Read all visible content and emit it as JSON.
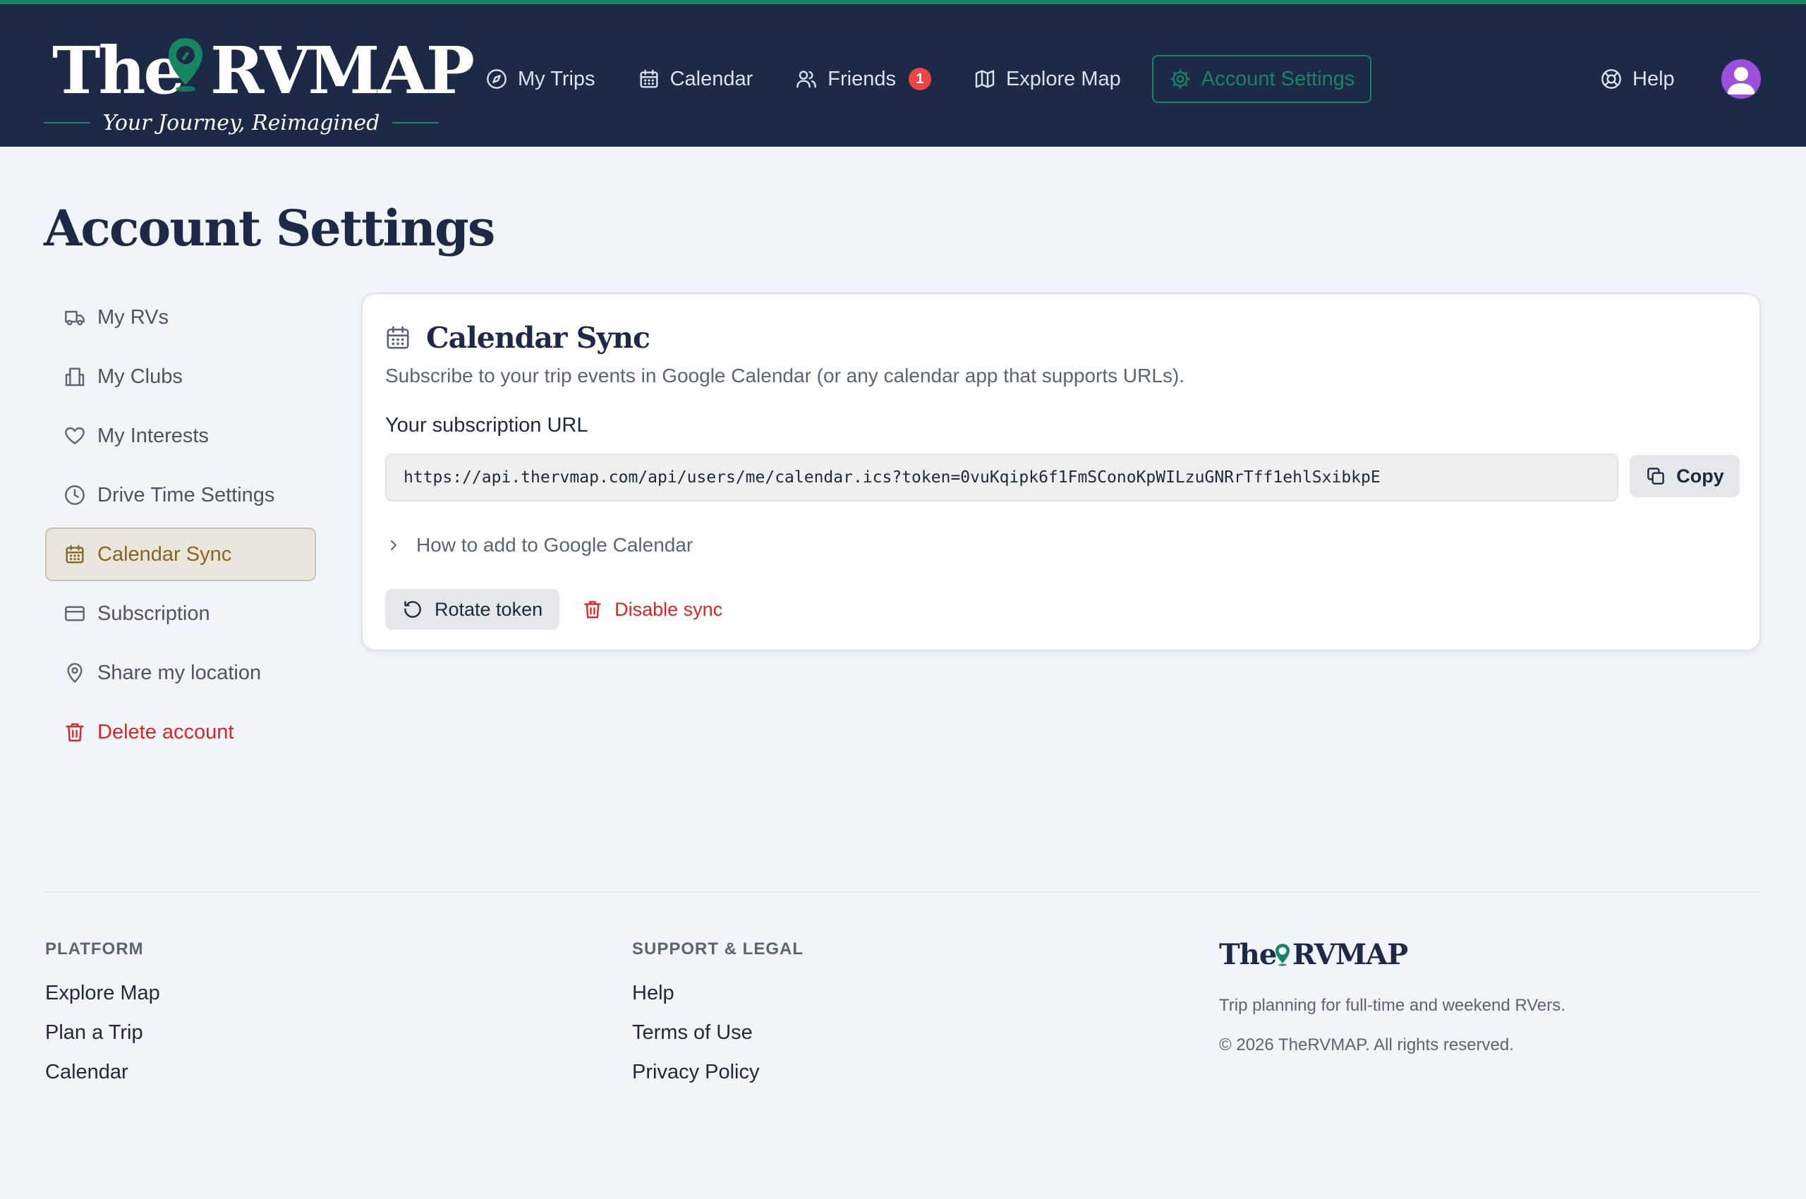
{
  "brand": {
    "word_left": "The",
    "word_right": "RVMAP",
    "tagline": "Your Journey, Reimagined",
    "accent_color": "#17855f",
    "header_bg": "#1c2a48"
  },
  "nav": {
    "items": [
      {
        "label": "My Trips",
        "icon": "compass-icon"
      },
      {
        "label": "Calendar",
        "icon": "calendar-icon"
      },
      {
        "label": "Friends",
        "icon": "users-icon",
        "badge": "1"
      },
      {
        "label": "Explore Map",
        "icon": "map-icon"
      },
      {
        "label": "Account Settings",
        "icon": "gear-icon",
        "active": true
      }
    ],
    "help_label": "Help"
  },
  "page": {
    "title": "Account Settings"
  },
  "sidebar": {
    "items": [
      {
        "label": "My RVs",
        "icon": "truck-icon"
      },
      {
        "label": "My Clubs",
        "icon": "building-icon"
      },
      {
        "label": "My Interests",
        "icon": "heart-icon"
      },
      {
        "label": "Drive Time Settings",
        "icon": "clock-icon"
      },
      {
        "label": "Calendar Sync",
        "icon": "calendar-icon",
        "active": true
      },
      {
        "label": "Subscription",
        "icon": "credit-card-icon"
      },
      {
        "label": "Share my location",
        "icon": "map-pin-icon"
      },
      {
        "label": "Delete account",
        "icon": "trash-icon",
        "danger": true
      }
    ]
  },
  "calendar_sync": {
    "title": "Calendar Sync",
    "description": "Subscribe to your trip events in Google Calendar (or any calendar app that supports URLs).",
    "url_label": "Your subscription URL",
    "url_value": "https://api.thervmap.com/api/users/me/calendar.ics?token=0vuKqipk6f1FmSConoKpWILzuGNRrTff1ehlSxibkpE",
    "copy_label": "Copy",
    "howto_label": "How to add to Google Calendar",
    "rotate_label": "Rotate token",
    "disable_label": "Disable sync"
  },
  "footer": {
    "platform": {
      "heading": "PLATFORM",
      "links": [
        "Explore Map",
        "Plan a Trip",
        "Calendar"
      ]
    },
    "support": {
      "heading": "SUPPORT & LEGAL",
      "links": [
        "Help",
        "Terms of Use",
        "Privacy Policy"
      ]
    },
    "tagline": "Trip planning for full-time and weekend RVers.",
    "copyright": "© 2026 TheRVMAP. All rights reserved."
  }
}
